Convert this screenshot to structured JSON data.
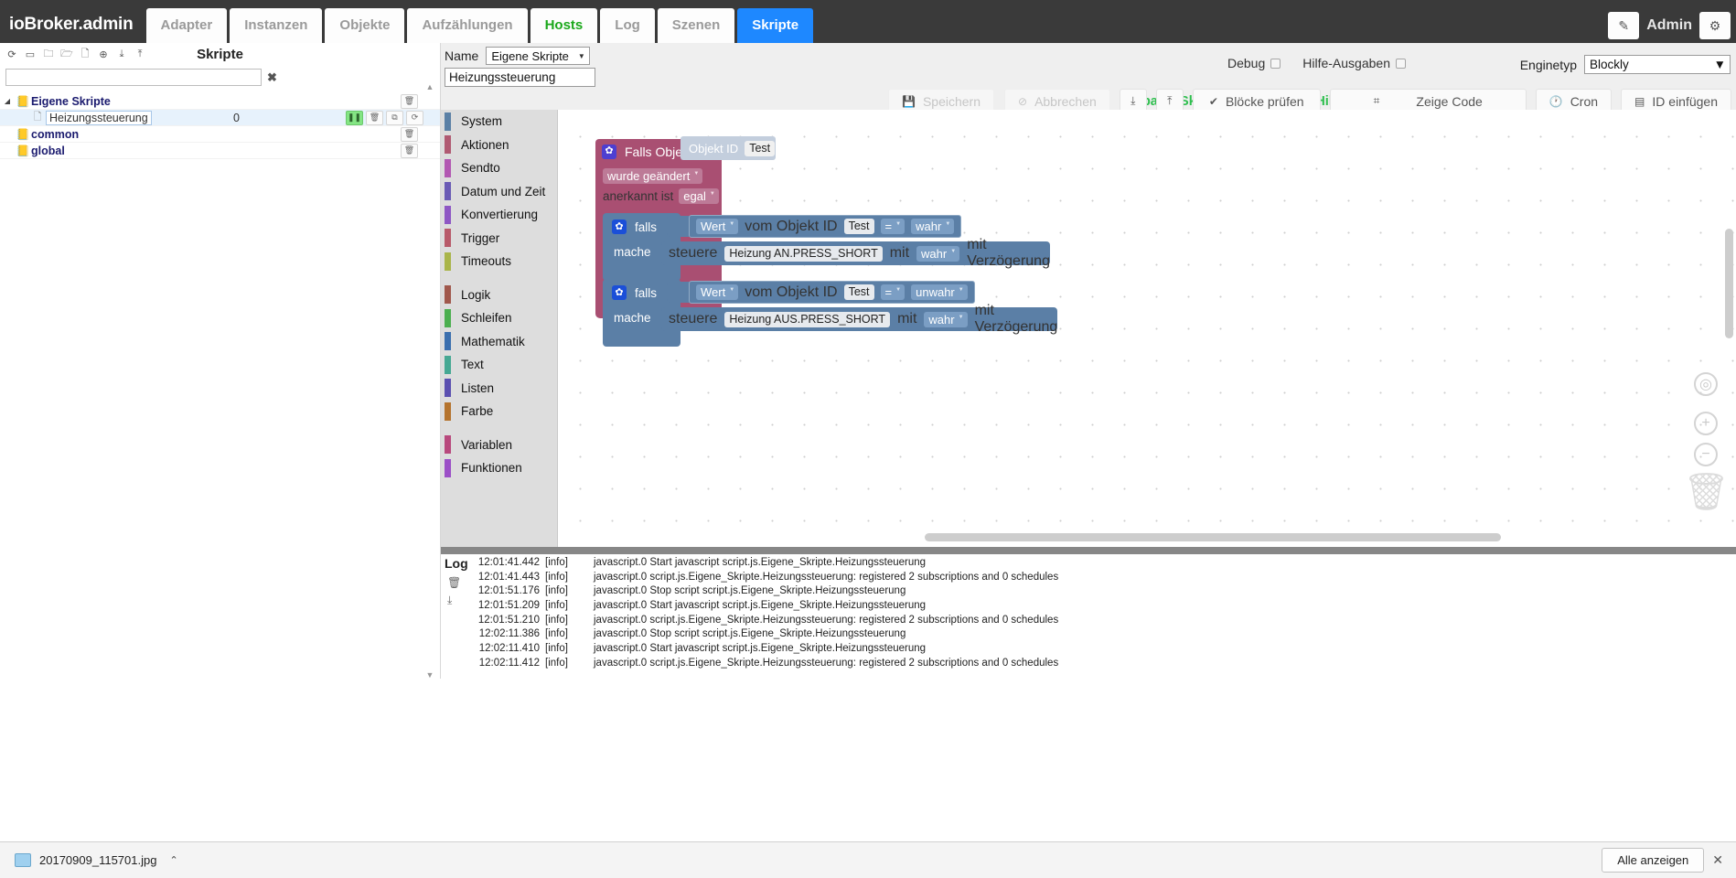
{
  "topnav": {
    "brand": "ioBroker.admin",
    "tabs": [
      {
        "label": "Adapter",
        "state": "normal"
      },
      {
        "label": "Instanzen",
        "state": "normal"
      },
      {
        "label": "Objekte",
        "state": "normal"
      },
      {
        "label": "Aufzählungen",
        "state": "normal"
      },
      {
        "label": "Hosts",
        "state": "green"
      },
      {
        "label": "Log",
        "state": "normal"
      },
      {
        "label": "Szenen",
        "state": "normal"
      },
      {
        "label": "Skripte",
        "state": "active"
      }
    ],
    "edit_icon": "pencil-icon",
    "user": "Admin",
    "settings_icon": "gear-icon"
  },
  "left_panel": {
    "title": "Skripte",
    "tools": [
      "refresh-icon",
      "collapse-icon",
      "new-folder-icon",
      "open-folder-icon",
      "new-file-icon",
      "add-icon",
      "import-icon",
      "export-icon"
    ],
    "search_value": "",
    "search_placeholder": "",
    "clear_label": "✖",
    "tree": [
      {
        "name": "Eigene Skripte",
        "type": "folder",
        "expanded": true,
        "indent": 0,
        "selected": false,
        "value": "",
        "buttons": [
          "delete-icon"
        ]
      },
      {
        "name": "Heizungssteuerung",
        "type": "script",
        "expanded": false,
        "indent": 1,
        "selected": true,
        "value": "0",
        "buttons": [
          "pause-icon",
          "delete-icon",
          "copy-icon",
          "restart-icon"
        ]
      },
      {
        "name": "common",
        "type": "folder",
        "expanded": false,
        "indent": 0,
        "selected": false,
        "value": "",
        "buttons": [
          "delete-icon"
        ]
      },
      {
        "name": "global",
        "type": "folder",
        "expanded": false,
        "indent": 0,
        "selected": false,
        "value": "",
        "buttons": [
          "delete-icon"
        ]
      }
    ]
  },
  "editor_header": {
    "name_label": "Name",
    "group_select_value": "Eigene Skripte",
    "script_name_value": "Heizungssteuerung",
    "debug_label": "Debug",
    "debug_checked": false,
    "help_output_label": "Hilfe-Ausgaben",
    "help_output_checked": false,
    "engine_label": "Enginetyp",
    "engine_value": "Blockly",
    "save_label": "Speichern",
    "cancel_label": "Abbrechen",
    "global_hint": "Globales Skript (klicke hier für Hilfe)",
    "export_label": "",
    "import_label": "",
    "check_blocks_label": "Blöcke prüfen",
    "show_code_label": "Zeige Code",
    "cron_label": "Cron",
    "insert_id_label": "ID einfügen"
  },
  "toolbox": {
    "groups": [
      {
        "items": [
          {
            "label": "System",
            "color": "#5b80a5"
          },
          {
            "label": "Aktionen",
            "color": "#b05a72"
          },
          {
            "label": "Sendto",
            "color": "#b258b2"
          },
          {
            "label": "Datum und Zeit",
            "color": "#6a5bb5"
          },
          {
            "label": "Konvertierung",
            "color": "#8e57c4"
          },
          {
            "label": "Trigger",
            "color": "#b85a6a"
          },
          {
            "label": "Timeouts",
            "color": "#a9b54a"
          }
        ]
      },
      {
        "items": [
          {
            "label": "Logik",
            "color": "#a0584c"
          },
          {
            "label": "Schleifen",
            "color": "#4caf50"
          },
          {
            "label": "Mathematik",
            "color": "#3b6fae"
          },
          {
            "label": "Text",
            "color": "#46a893"
          },
          {
            "label": "Listen",
            "color": "#5b50b0"
          },
          {
            "label": "Farbe",
            "color": "#b5742e"
          }
        ]
      },
      {
        "items": [
          {
            "label": "Variablen",
            "color": "#b8497d"
          },
          {
            "label": "Funktionen",
            "color": "#9b4fc7"
          }
        ]
      }
    ]
  },
  "blocks": {
    "trigger": {
      "gear_icon": "gear-icon",
      "title": "Falls Objekt",
      "objid_label": "Objekt ID",
      "objid_value": "Test",
      "change_mode": "wurde geändert",
      "ack_label": "anerkannt ist",
      "ack_value": "egal"
    },
    "branches": [
      {
        "gear_icon": "gear-icon",
        "if_label": "falls",
        "cond_left": "Wert",
        "cond_mid": "vom Objekt ID",
        "cond_obj": "Test",
        "cond_op": "=",
        "cond_right": "wahr",
        "do_label": "mache",
        "action_verb": "steuere",
        "action_target": "Heizung AN.PRESS_SHORT",
        "action_with": "mit",
        "action_value": "wahr",
        "delay_label": "mit Verzögerung",
        "delay_checked": false
      },
      {
        "gear_icon": "gear-icon",
        "if_label": "falls",
        "cond_left": "Wert",
        "cond_mid": "vom Objekt ID",
        "cond_obj": "Test",
        "cond_op": "=",
        "cond_right": "unwahr",
        "do_label": "mache",
        "action_verb": "steuere",
        "action_target": "Heizung AUS.PRESS_SHORT",
        "action_with": "mit",
        "action_value": "wahr",
        "delay_label": "mit Verzögerung",
        "delay_checked": false
      }
    ],
    "controls": {
      "center_icon": "target-icon",
      "zoom_in_label": "+",
      "zoom_out_label": "−",
      "trash_icon": "trash-icon"
    }
  },
  "log": {
    "title": "Log",
    "tools": [
      "delete-icon",
      "download-icon"
    ],
    "entries": [
      {
        "time": "12:01:41.442",
        "severity": "[info]",
        "message": "javascript.0 Start javascript script.js.Eigene_Skripte.Heizungssteuerung"
      },
      {
        "time": "12:01:41.443",
        "severity": "[info]",
        "message": "javascript.0 script.js.Eigene_Skripte.Heizungssteuerung: registered 2 subscriptions and 0 schedules"
      },
      {
        "time": "12:01:51.176",
        "severity": "[info]",
        "message": "javascript.0 Stop script script.js.Eigene_Skripte.Heizungssteuerung"
      },
      {
        "time": "12:01:51.209",
        "severity": "[info]",
        "message": "javascript.0 Start javascript script.js.Eigene_Skripte.Heizungssteuerung"
      },
      {
        "time": "12:01:51.210",
        "severity": "[info]",
        "message": "javascript.0 script.js.Eigene_Skripte.Heizungssteuerung: registered 2 subscriptions and 0 schedules"
      },
      {
        "time": "12:02:11.386",
        "severity": "[info]",
        "message": "javascript.0 Stop script script.js.Eigene_Skripte.Heizungssteuerung"
      },
      {
        "time": "12:02:11.410",
        "severity": "[info]",
        "message": "javascript.0 Start javascript script.js.Eigene_Skripte.Heizungssteuerung"
      },
      {
        "time": "12:02:11.412",
        "severity": "[info]",
        "message": "javascript.0 script.js.Eigene_Skripte.Heizungssteuerung: registered 2 subscriptions and 0 schedules"
      }
    ]
  },
  "bottombar": {
    "download_name": "20170909_115701.jpg",
    "caret_label": "⌃",
    "show_all_label": "Alle anzeigen",
    "close_label": "✕"
  }
}
